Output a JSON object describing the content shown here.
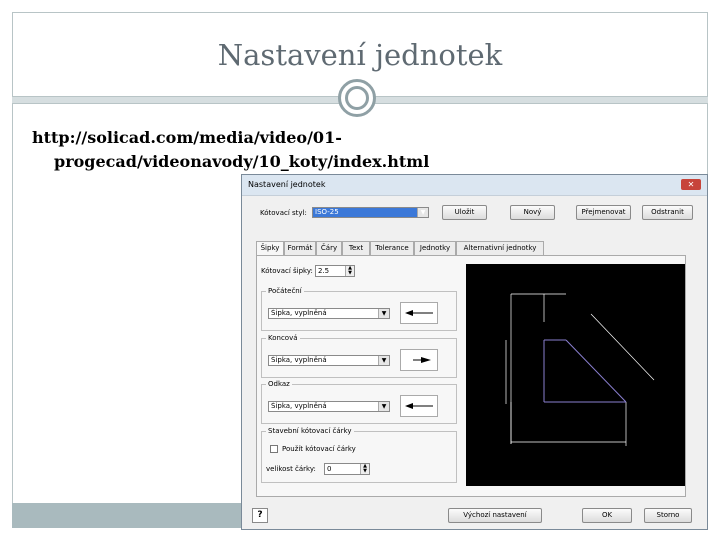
{
  "slide": {
    "title": "Nastavení jednotek",
    "link_line1": "http://solicad.com/media/video/01-",
    "link_line2": "progecad/videonavody/10_koty/index.html"
  },
  "dialog": {
    "title": "Nastavení jednotek",
    "close_label": "✕",
    "style_label": "Kótovací styl:",
    "style_value": "ISO-25",
    "buttons": {
      "save": "Uložit",
      "new": "Nový",
      "rename": "Přejmenovat",
      "delete": "Odstranit"
    },
    "tabs": [
      "Šipky",
      "Formát",
      "Čáry",
      "Text",
      "Tolerance",
      "Jednotky",
      "Alternativní jednotky"
    ],
    "arrow_size_label": "Kótovací šipky:",
    "arrow_size_value": "2.5",
    "groups": {
      "start": {
        "label": "Počáteční",
        "value": "Šipka, vyplněná"
      },
      "end": {
        "label": "Koncová",
        "value": "Šipka, vyplněná"
      },
      "leader": {
        "label": "Odkaz",
        "value": "Šipka, vyplněná"
      },
      "tick": {
        "label": "Stavební kótovací čárky",
        "checkbox_label": "Použít kótovací čárky",
        "size_label": "velikost čárky:",
        "size_value": "0"
      }
    },
    "footer": {
      "help": "?",
      "defaults": "Výchozí nastavení",
      "ok": "OK",
      "cancel": "Storno"
    }
  }
}
